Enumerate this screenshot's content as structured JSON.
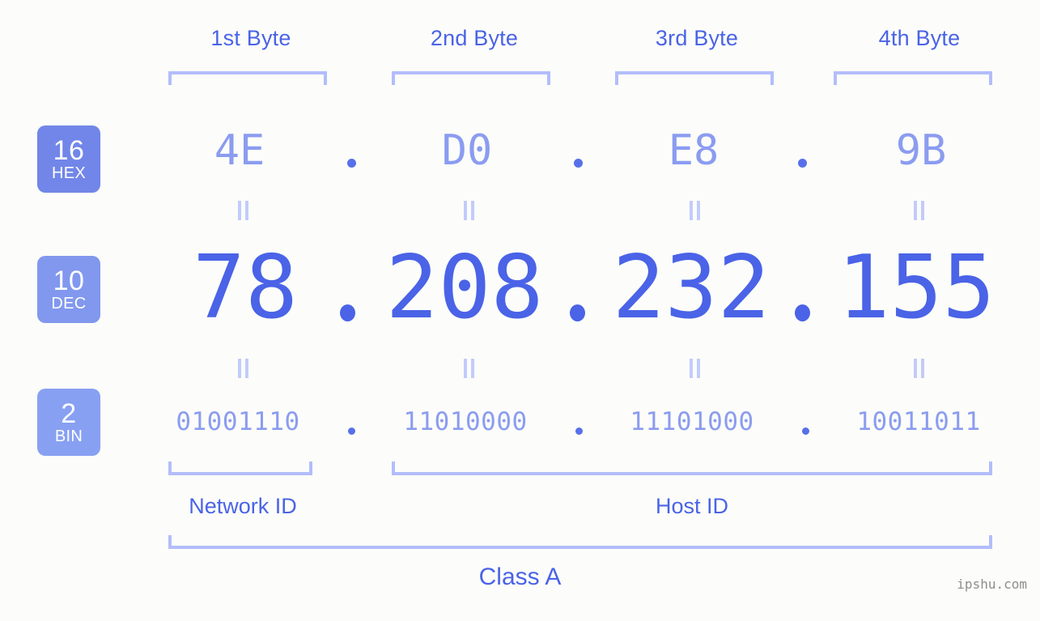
{
  "meta": {
    "background": "#fcfdfa",
    "accent_strong": "#4a63e7",
    "accent_mid": "#8b9cf0",
    "accent_light": "#b3bdfb",
    "badge_hex_bg": "#7186e8",
    "badge_dec_bg": "#8198ee",
    "badge_bin_bg": "#88a0f2"
  },
  "byte_headers": [
    {
      "label": "1st Byte"
    },
    {
      "label": "2nd Byte"
    },
    {
      "label": "3rd Byte"
    },
    {
      "label": "4th Byte"
    }
  ],
  "bases": [
    {
      "number": "16",
      "name": "HEX"
    },
    {
      "number": "10",
      "name": "DEC"
    },
    {
      "number": "2",
      "name": "BIN"
    }
  ],
  "rows": {
    "hex": {
      "base_number": "16",
      "base_name": "HEX",
      "values": [
        "4E",
        "D0",
        "E8",
        "9B"
      ],
      "separator": "."
    },
    "dec": {
      "base_number": "10",
      "base_name": "DEC",
      "values": [
        "78",
        "208",
        "232",
        "155"
      ],
      "separator": "."
    },
    "bin": {
      "base_number": "2",
      "base_name": "BIN",
      "values": [
        "01001110",
        "11010000",
        "11101000",
        "10011011"
      ],
      "separator": "."
    }
  },
  "equals_symbol": "=",
  "segments": {
    "network_id": "Network ID",
    "host_id": "Host ID"
  },
  "class_label": "Class A",
  "watermark": "ipshu.com"
}
